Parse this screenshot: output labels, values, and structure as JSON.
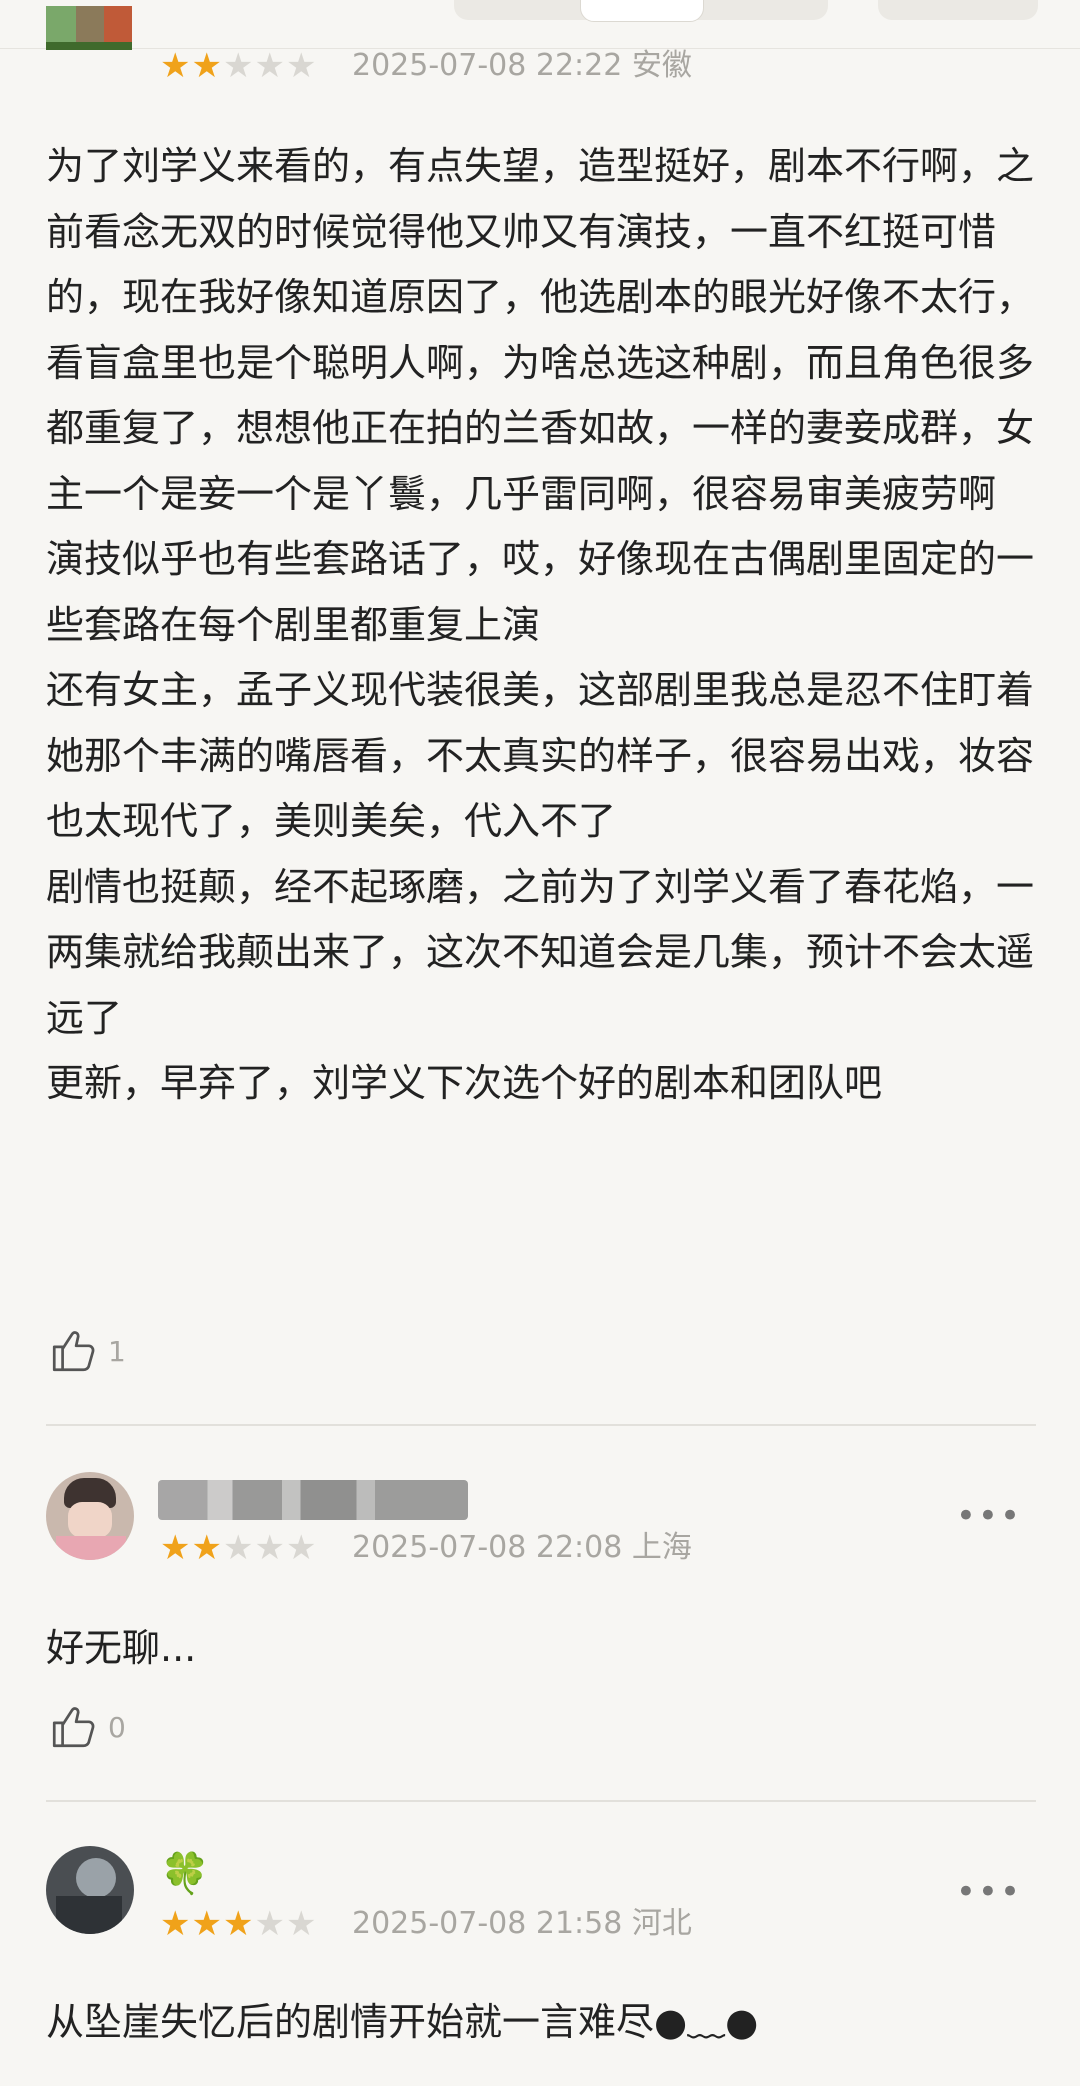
{
  "reviews": [
    {
      "username": "",
      "rating": 2,
      "stars": "★★★★★",
      "date": "2025-07-08 22:22",
      "location": "安徽",
      "content": "为了刘学义来看的，有点失望，造型挺好，剧本不行啊，之前看念无双的时候觉得他又帅又有演技，一直不红挺可惜的，现在我好像知道原因了，他选剧本的眼光好像不太行，看盲盒里也是个聪明人啊，为啥总选这种剧，而且角色很多都重复了，想想他正在拍的兰香如故，一样的妻妾成群，女主一个是妾一个是丫鬟，几乎雷同啊，很容易审美疲劳啊\n演技似乎也有些套路话了，哎，好像现在古偶剧里固定的一些套路在每个剧里都重复上演\n还有女主，孟子义现代装很美，这部剧里我总是忍不住盯着她那个丰满的嘴唇看，不太真实的样子，很容易出戏，妆容也太现代了，美则美矣，代入不了\n剧情也挺颠，经不起琢磨，之前为了刘学义看了春花焰，一两集就给我颠出来了，这次不知道会是几集，预计不会太遥远了\n更新，早弃了，刘学义下次选个好的剧本和团队吧",
      "likes": "1"
    },
    {
      "username": "",
      "rating": 2,
      "stars": "★★★★★",
      "date": "2025-07-08 22:08",
      "location": "上海",
      "content": "好无聊...",
      "likes": "0",
      "more": "•••"
    },
    {
      "username": "🍀",
      "rating": 3,
      "stars": "★★★★★",
      "date": "2025-07-08 21:58",
      "location": "河北",
      "content": "从坠崖失忆后的剧情开始就一言难尽●﹏●",
      "more": "•••"
    }
  ]
}
